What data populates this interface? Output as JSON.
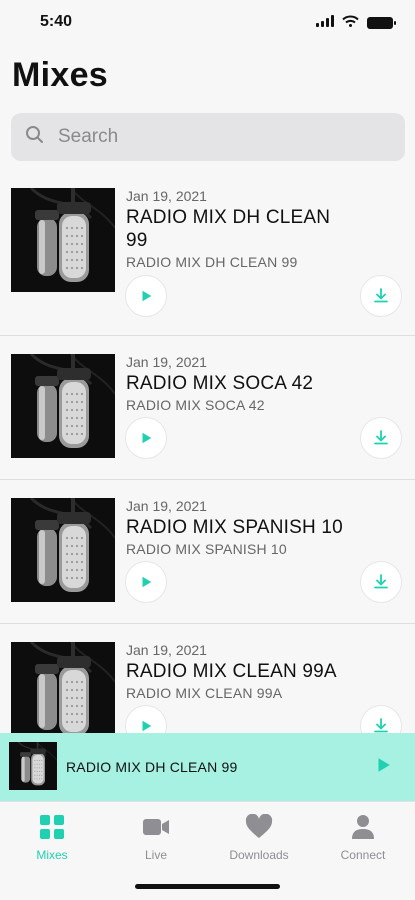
{
  "status_bar": {
    "time": "5:40"
  },
  "page": {
    "title": "Mixes"
  },
  "search": {
    "placeholder": "Search"
  },
  "mixes": [
    {
      "date": "Jan 19, 2021",
      "title": "RADIO MIX DH CLEAN 99",
      "subtitle": "RADIO MIX DH CLEAN 99"
    },
    {
      "date": "Jan 19, 2021",
      "title": "RADIO MIX SOCA 42",
      "subtitle": "RADIO MIX SOCA 42"
    },
    {
      "date": "Jan 19, 2021",
      "title": "RADIO MIX SPANISH 10",
      "subtitle": "RADIO MIX SPANISH 10"
    },
    {
      "date": "Jan 19, 2021",
      "title": "RADIO MIX CLEAN 99A",
      "subtitle": "RADIO MIX CLEAN 99A"
    }
  ],
  "now_playing": {
    "title": "RADIO MIX DH CLEAN 99"
  },
  "tabs": [
    {
      "label": "Mixes",
      "icon": "grid-icon"
    },
    {
      "label": "Live",
      "icon": "video-camera-icon"
    },
    {
      "label": "Downloads",
      "icon": "heart-icon"
    },
    {
      "label": "Connect",
      "icon": "person-icon"
    }
  ],
  "colors": {
    "accent": "#1fd1b0",
    "mini_player_bg": "#a6f1e2",
    "tab_inactive": "#8e8e93"
  }
}
